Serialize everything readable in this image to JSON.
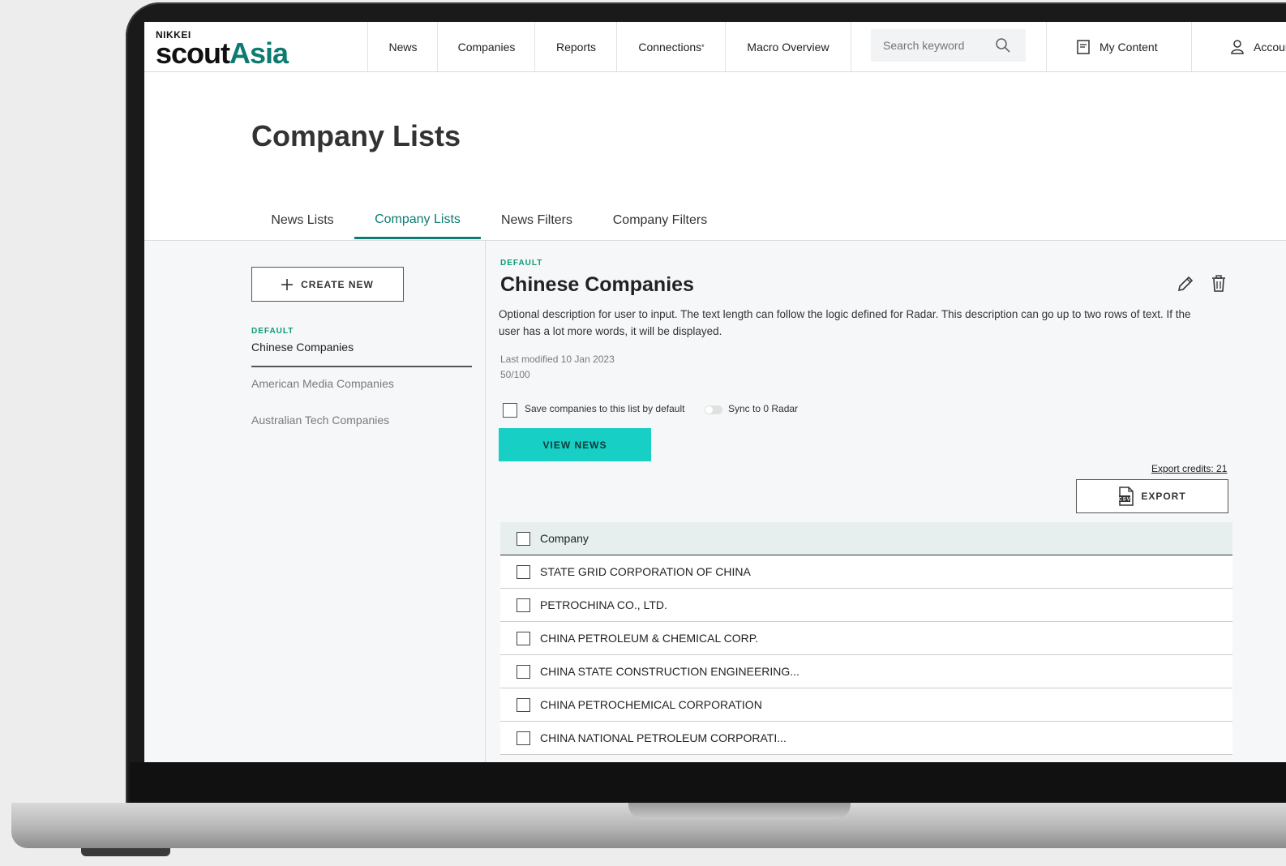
{
  "nav": {
    "logo_small": "NIKKEI",
    "logo_scout": "scout",
    "logo_asia": "Asia",
    "items": [
      {
        "label": "News"
      },
      {
        "label": "Companies"
      },
      {
        "label": "Reports"
      },
      {
        "label": "Connections",
        "suffix": "*"
      },
      {
        "label": "Macro Overview"
      }
    ],
    "search_placeholder": "Search keyword",
    "my_content": "My Content",
    "account": "Account"
  },
  "page": {
    "title": "Company Lists",
    "tabs": [
      {
        "label": "News Lists"
      },
      {
        "label": "Company Lists",
        "active": true
      },
      {
        "label": "News Filters"
      },
      {
        "label": "Company Filters"
      }
    ]
  },
  "sidebar": {
    "create_new": "CREATE NEW",
    "active_item": {
      "tag": "DEFAULT",
      "name": "Chinese Companies"
    },
    "items": [
      {
        "name": "American Media Companies"
      },
      {
        "name": "Australian Tech Companies"
      }
    ]
  },
  "detail": {
    "tag": "DEFAULT",
    "title": "Chinese Companies",
    "description": "Optional description for user to input. The text length can follow the logic defined for Radar. This description can go up to two rows of text. If the user has a lot more words, it will be displayed.",
    "last_modified": "Last modified 10 Jan 2023",
    "count": "50/100",
    "save_default_label": "Save companies to this list by default",
    "save_default_checked": false,
    "sync_label": "Sync to 0 Radar",
    "sync_on": false,
    "view_news": "VIEW NEWS",
    "export_credits": "Export credits: 21",
    "export": "EXPORT",
    "export_icon_text": "CSV"
  },
  "table": {
    "header": "Company",
    "rows": [
      "STATE GRID CORPORATION OF CHINA",
      "PETROCHINA CO., LTD.",
      "CHINA PETROLEUM & CHEMICAL CORP.",
      "CHINA STATE CONSTRUCTION ENGINEERING...",
      "CHINA PETROCHEMICAL CORPORATION",
      "CHINA NATIONAL PETROLEUM CORPORATI..."
    ]
  },
  "colors": {
    "accent": "#0e7b73",
    "tag_green": "#0e9a76",
    "button_teal": "#17cfc4",
    "table_header_bg": "#e6efee"
  }
}
